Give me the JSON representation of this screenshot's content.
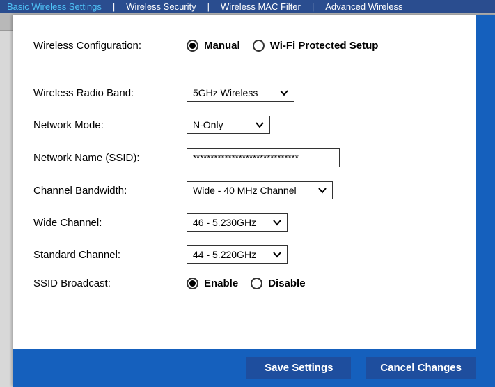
{
  "tabs": {
    "basic": "Basic Wireless Settings",
    "security": "Wireless Security",
    "mac": "Wireless MAC Filter",
    "advanced": "Advanced Wireless"
  },
  "config": {
    "label": "Wireless Configuration:",
    "manual": "Manual",
    "wps": "Wi-Fi Protected Setup"
  },
  "form": {
    "radio_band": {
      "label": "Wireless Radio Band:",
      "value": "5GHz Wireless"
    },
    "network_mode": {
      "label": "Network Mode:",
      "value": "N-Only"
    },
    "ssid": {
      "label": "Network Name (SSID):",
      "value": "******************************"
    },
    "bandwidth": {
      "label": "Channel Bandwidth:",
      "value": "Wide - 40 MHz Channel"
    },
    "wide_channel": {
      "label": "Wide Channel:",
      "value": "46 - 5.230GHz"
    },
    "std_channel": {
      "label": "Standard Channel:",
      "value": "44 - 5.220GHz"
    },
    "broadcast": {
      "label": "SSID Broadcast:",
      "enable": "Enable",
      "disable": "Disable"
    }
  },
  "buttons": {
    "save": "Save Settings",
    "cancel": "Cancel Changes"
  }
}
